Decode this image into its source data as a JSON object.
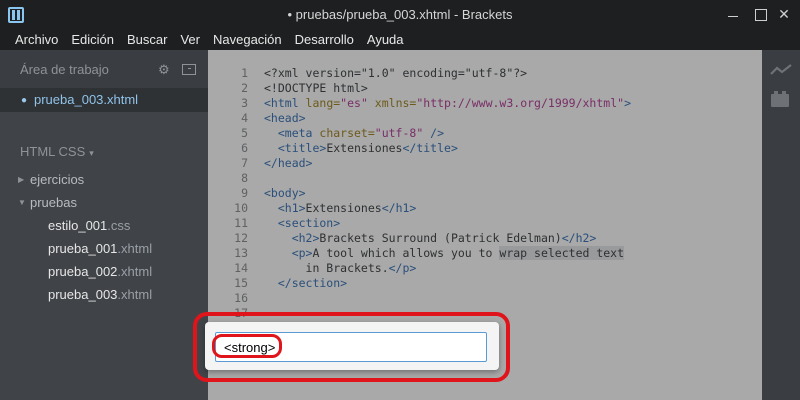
{
  "window": {
    "title": "• pruebas/prueba_003.xhtml - Brackets"
  },
  "menu": [
    "Archivo",
    "Edición",
    "Buscar",
    "Ver",
    "Navegación",
    "Desarrollo",
    "Ayuda"
  ],
  "sidebar": {
    "working_set_title": "Área de trabajo",
    "working_files": [
      {
        "name": "prueba_003.xhtml"
      }
    ],
    "project_name": "HTML CSS",
    "project_caret": "▾",
    "folders": [
      {
        "name": "ejercicios",
        "expanded": false
      },
      {
        "name": "pruebas",
        "expanded": true
      }
    ],
    "files": [
      {
        "base": "estilo_001",
        "ext": ".css"
      },
      {
        "base": "prueba_001",
        "ext": ".xhtml"
      },
      {
        "base": "prueba_002",
        "ext": ".xhtml"
      },
      {
        "base": "prueba_003",
        "ext": ".xhtml"
      }
    ]
  },
  "editor": {
    "line_numbers": [
      "1",
      "2",
      "3",
      "4",
      "5",
      "6",
      "7",
      "8",
      "9",
      "10",
      "11",
      "12",
      "13",
      "14",
      "15",
      "16",
      "17"
    ],
    "lines": [
      [
        {
          "t": "<?xml version=\"1.0\" encoding=\"utf-8\"?>",
          "c": "txt"
        }
      ],
      [
        {
          "t": "<!DOCTYPE html>",
          "c": "txt"
        }
      ],
      [
        {
          "t": "<html ",
          "c": "tag"
        },
        {
          "t": "lang=",
          "c": "attr"
        },
        {
          "t": "\"es\"",
          "c": "str"
        },
        {
          "t": " xmlns=",
          "c": "attr"
        },
        {
          "t": "\"http://www.w3.org/1999/xhtml\"",
          "c": "str"
        },
        {
          "t": ">",
          "c": "tag"
        }
      ],
      [
        {
          "t": "<head>",
          "c": "tag"
        }
      ],
      [
        {
          "t": "  <meta ",
          "c": "tag"
        },
        {
          "t": "charset=",
          "c": "attr"
        },
        {
          "t": "\"utf-8\"",
          "c": "str"
        },
        {
          "t": " />",
          "c": "tag"
        }
      ],
      [
        {
          "t": "  <title>",
          "c": "tag"
        },
        {
          "t": "Extensiones",
          "c": "txt"
        },
        {
          "t": "</title>",
          "c": "tag"
        }
      ],
      [
        {
          "t": "</head>",
          "c": "tag"
        }
      ],
      [
        {
          "t": "",
          "c": "txt"
        }
      ],
      [
        {
          "t": "<body>",
          "c": "tag"
        }
      ],
      [
        {
          "t": "  <h1>",
          "c": "tag"
        },
        {
          "t": "Extensiones",
          "c": "txt"
        },
        {
          "t": "</h1>",
          "c": "tag"
        }
      ],
      [
        {
          "t": "  <section>",
          "c": "tag"
        }
      ],
      [
        {
          "t": "    <h2>",
          "c": "tag"
        },
        {
          "t": "Brackets Surround (Patrick Edelman)",
          "c": "txt"
        },
        {
          "t": "</h2>",
          "c": "tag"
        }
      ],
      [
        {
          "t": "    <p>",
          "c": "tag"
        },
        {
          "t": "A tool which allows you to ",
          "c": "txt"
        },
        {
          "t": "wrap selected text",
          "c": "txt sel"
        }
      ],
      [
        {
          "t": "      in Brackets.",
          "c": "txt"
        },
        {
          "t": "</p>",
          "c": "tag"
        }
      ],
      [
        {
          "t": "  </section>",
          "c": "tag"
        }
      ],
      [
        {
          "t": "",
          "c": "txt"
        }
      ],
      [
        {
          "t": "",
          "c": "txt"
        }
      ]
    ]
  },
  "surround_dialog": {
    "input_value": "<strong>"
  },
  "colors": {
    "accent_file": "#8fc3ea",
    "highlight": "#e0141b",
    "input_border": "#5a9bd5"
  }
}
